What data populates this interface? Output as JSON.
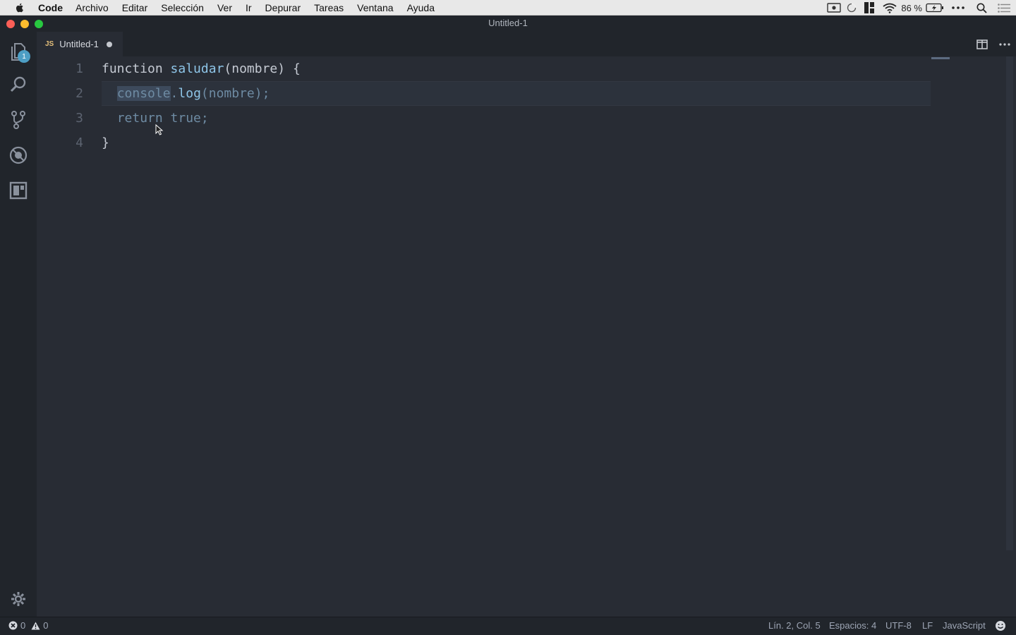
{
  "menubar": {
    "app": "Code",
    "items": [
      "Archivo",
      "Editar",
      "Selección",
      "Ver",
      "Ir",
      "Depurar",
      "Tareas",
      "Ventana",
      "Ayuda"
    ],
    "battery": "86 %"
  },
  "window": {
    "title": "Untitled-1"
  },
  "activity": {
    "explorer_badge": "1"
  },
  "tab": {
    "lang": "JS",
    "name": "Untitled-1"
  },
  "editor": {
    "lines": [
      {
        "num": "1"
      },
      {
        "num": "2"
      },
      {
        "num": "3"
      },
      {
        "num": "4"
      }
    ],
    "tokens": {
      "l1_kw": "function ",
      "l1_fn": "saludar",
      "l1_rest": "(nombre) {",
      "l2_indent": "  ",
      "l2_sel": "console",
      "l2_dot": ".",
      "l2_fn": "log",
      "l2_rest": "(nombre);",
      "l3_indent": "  ",
      "l3_kw": "return true;",
      "l4": "}"
    }
  },
  "statusbar": {
    "errors": "0",
    "warnings": "0",
    "position": "Lín. 2, Col. 5",
    "spaces": "Espacios: 4",
    "encoding": "UTF-8",
    "eol": "LF",
    "language": "JavaScript"
  }
}
